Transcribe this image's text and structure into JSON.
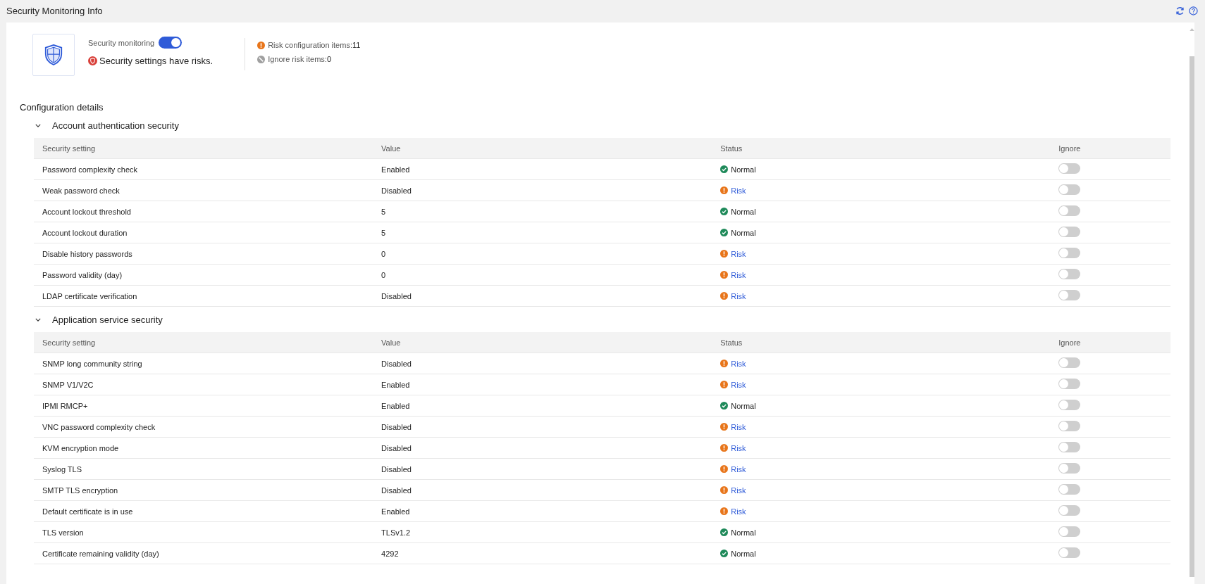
{
  "page_title": "Security Monitoring Info",
  "summary": {
    "monitoring_label": "Security monitoring",
    "monitoring_on": true,
    "state_text": "Security settings have risks.",
    "risk_label": "Risk configuration items:",
    "risk_count": "11",
    "ignore_label": "Ignore risk items:",
    "ignore_count": "0"
  },
  "details_title": "Configuration details",
  "sections": [
    {
      "title": "Account authentication security",
      "expanded": true,
      "columns": [
        "Security setting",
        "Value",
        "Status",
        "Ignore"
      ],
      "rows": [
        {
          "setting": "Password complexity check",
          "value": "Enabled",
          "status": "Normal",
          "kind": "normal",
          "ignored": false
        },
        {
          "setting": "Weak password check",
          "value": "Disabled",
          "status": "Risk",
          "kind": "risk",
          "ignored": false
        },
        {
          "setting": "Account lockout threshold",
          "value": "5",
          "status": "Normal",
          "kind": "normal",
          "ignored": false
        },
        {
          "setting": "Account lockout duration",
          "value": "5",
          "status": "Normal",
          "kind": "normal",
          "ignored": false
        },
        {
          "setting": "Disable history passwords",
          "value": "0",
          "status": "Risk",
          "kind": "risk",
          "ignored": false
        },
        {
          "setting": "Password validity (day)",
          "value": "0",
          "status": "Risk",
          "kind": "risk",
          "ignored": false
        },
        {
          "setting": "LDAP certificate verification",
          "value": "Disabled",
          "status": "Risk",
          "kind": "risk",
          "ignored": false
        }
      ]
    },
    {
      "title": "Application service security",
      "expanded": true,
      "columns": [
        "Security setting",
        "Value",
        "Status",
        "Ignore"
      ],
      "rows": [
        {
          "setting": "SNMP long community string",
          "value": "Disabled",
          "status": "Risk",
          "kind": "risk",
          "ignored": false
        },
        {
          "setting": "SNMP V1/V2C",
          "value": "Enabled",
          "status": "Risk",
          "kind": "risk",
          "ignored": false
        },
        {
          "setting": "IPMI RMCP+",
          "value": "Enabled",
          "status": "Normal",
          "kind": "normal",
          "ignored": false
        },
        {
          "setting": "VNC password complexity check",
          "value": "Disabled",
          "status": "Risk",
          "kind": "risk",
          "ignored": false
        },
        {
          "setting": "KVM encryption mode",
          "value": "Disabled",
          "status": "Risk",
          "kind": "risk",
          "ignored": false
        },
        {
          "setting": "Syslog TLS",
          "value": "Disabled",
          "status": "Risk",
          "kind": "risk",
          "ignored": false
        },
        {
          "setting": "SMTP TLS encryption",
          "value": "Disabled",
          "status": "Risk",
          "kind": "risk",
          "ignored": false
        },
        {
          "setting": "Default certificate is in use",
          "value": "Enabled",
          "status": "Risk",
          "kind": "risk",
          "ignored": false
        },
        {
          "setting": "TLS version",
          "value": "TLSv1.2",
          "status": "Normal",
          "kind": "normal",
          "ignored": false
        },
        {
          "setting": "Certificate remaining validity (day)",
          "value": "4292",
          "status": "Normal",
          "kind": "normal",
          "ignored": false
        }
      ]
    }
  ]
}
